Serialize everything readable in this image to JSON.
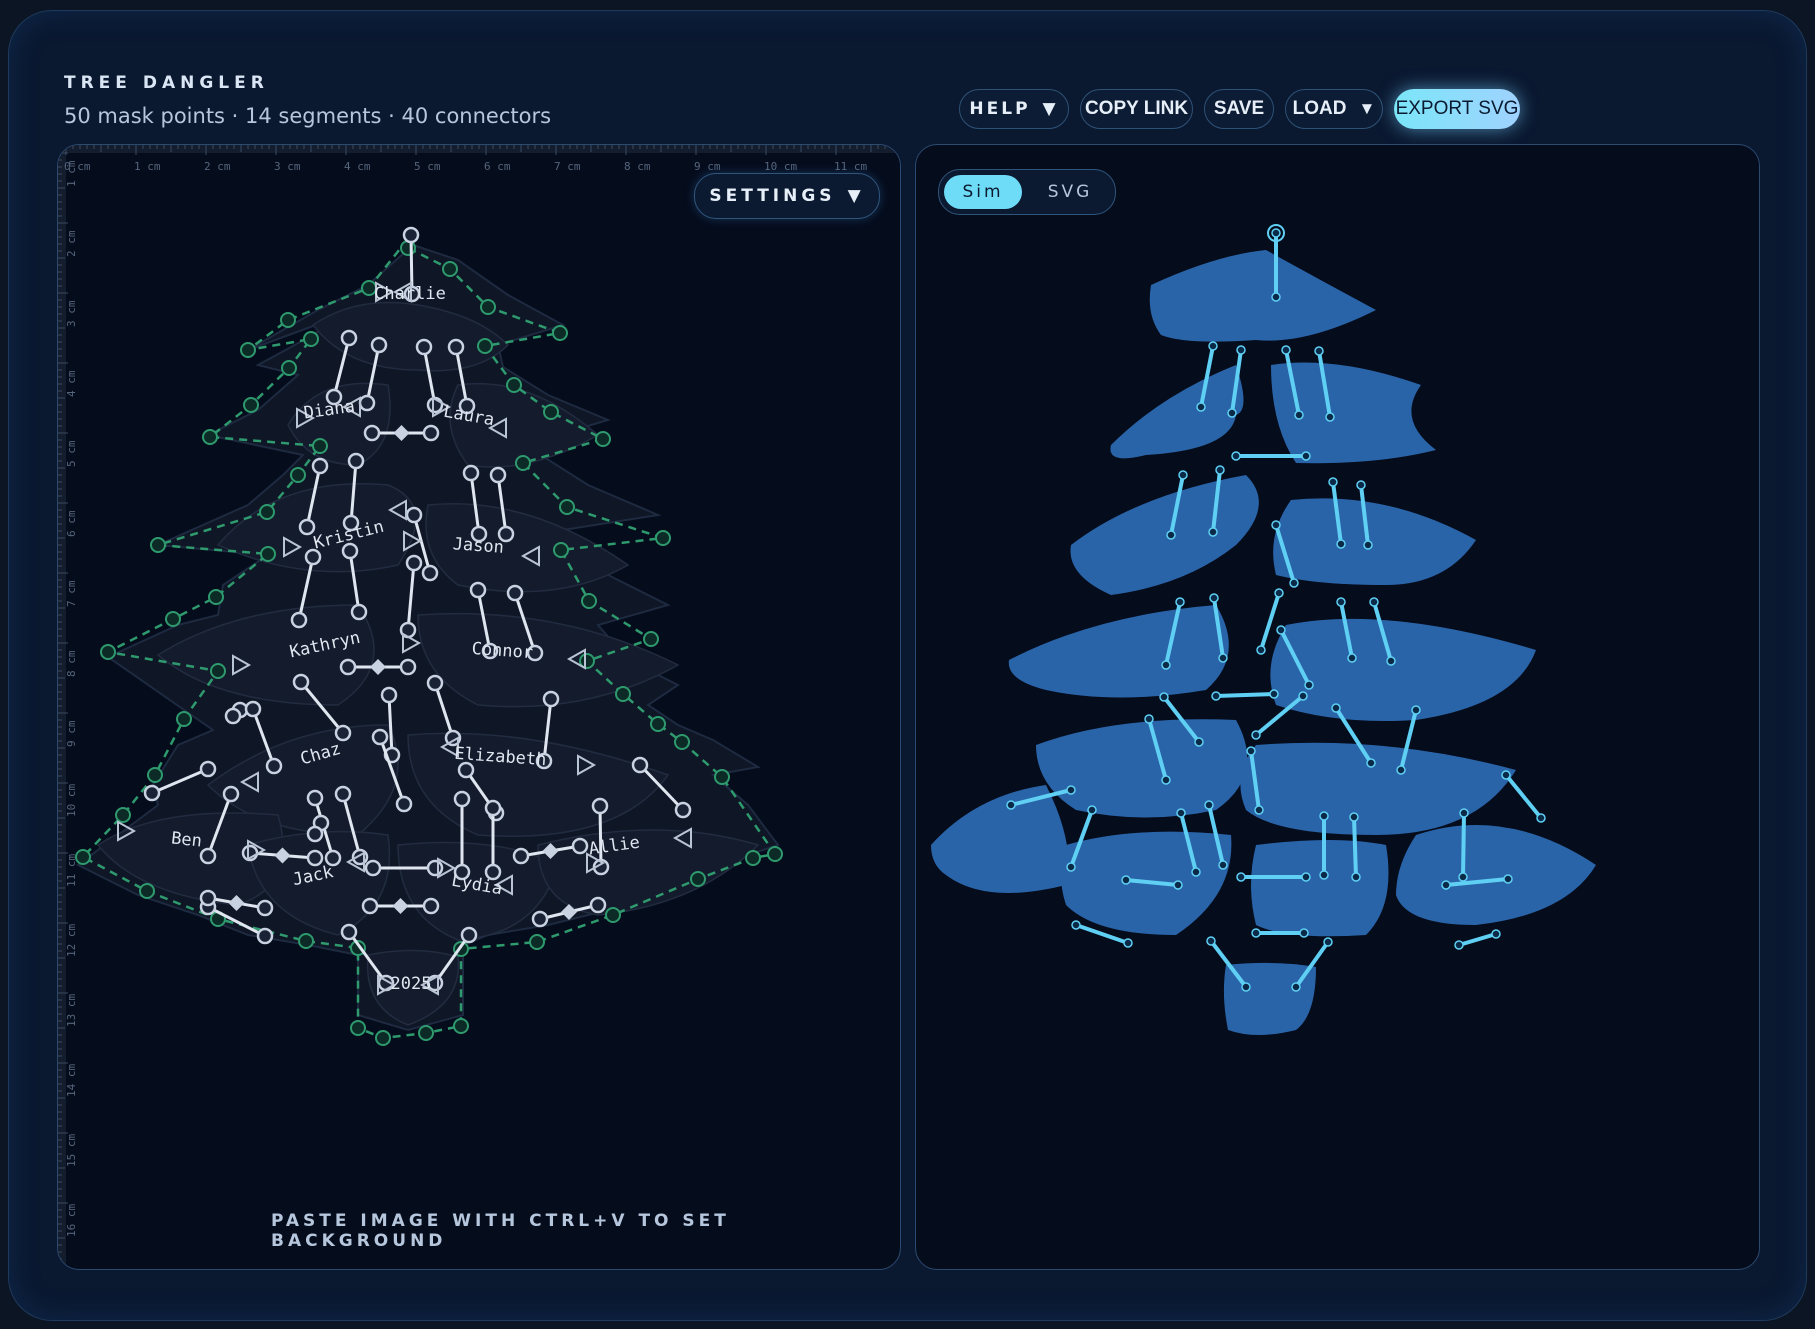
{
  "header": {
    "title": "TREE DANGLER",
    "stats": "50 mask points · 14 segments · 40 connectors"
  },
  "toolbar": {
    "help": "HELP",
    "copy_link": "COPY LINK",
    "save": "SAVE",
    "load": "LOAD",
    "export": "EXPORT SVG",
    "caret": "▼"
  },
  "editor": {
    "settings": "SETTINGS",
    "hint": "PASTE IMAGE WITH CTRL+V TO SET BACKGROUND",
    "ruler_x": [
      "0 cm",
      "1 cm",
      "2 cm",
      "3 cm",
      "4 cm",
      "5 cm",
      "6 cm",
      "7 cm",
      "8 cm",
      "9 cm",
      "10 cm",
      "11 cm"
    ],
    "ruler_y": [
      "1 cm",
      "2 cm",
      "3 cm",
      "4 cm",
      "5 cm",
      "6 cm",
      "7 cm",
      "8 cm",
      "9 cm",
      "10 cm",
      "11 cm",
      "12 cm",
      "13 cm",
      "14 cm",
      "15 cm",
      "16 cm"
    ],
    "segment_names": [
      "Charlie",
      "Diana",
      "Laura",
      "Kristin",
      "Jason",
      "Kathryn",
      "Connor",
      "Chaz",
      "Elizabeth",
      "Ben",
      "Jack",
      "Lydia",
      "Allie",
      "2025"
    ]
  },
  "preview": {
    "tabs": [
      "Sim",
      "SVG"
    ],
    "active_tab": "Sim"
  },
  "colors": {
    "accent": "#6fdcf7",
    "mask_dashes": "#2e9a6e",
    "piece_fill": "#2a64a8"
  }
}
